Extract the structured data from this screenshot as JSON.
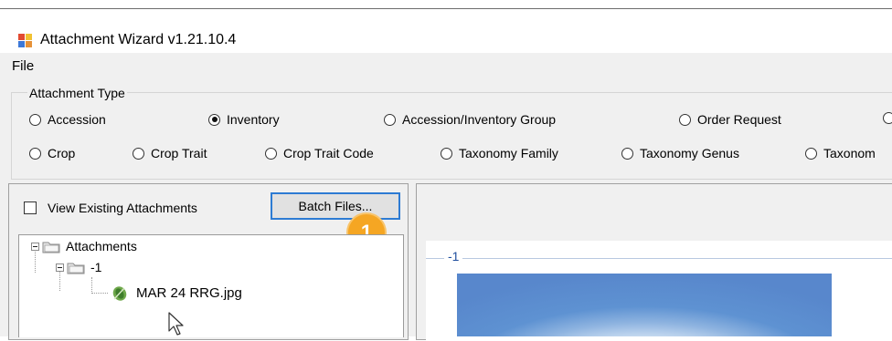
{
  "window": {
    "title": "Attachment Wizard v1.21.10.4"
  },
  "menu": {
    "items": [
      "File"
    ]
  },
  "attachment_type": {
    "legend": "Attachment Type",
    "row1": [
      {
        "label": "Accession",
        "selected": false
      },
      {
        "label": "Inventory",
        "selected": true
      },
      {
        "label": "Accession/Inventory Group",
        "selected": false
      },
      {
        "label": "Order Request",
        "selected": false
      }
    ],
    "row2": [
      {
        "label": "Crop",
        "selected": false
      },
      {
        "label": "Crop Trait",
        "selected": false
      },
      {
        "label": "Crop Trait Code",
        "selected": false
      },
      {
        "label": "Taxonomy Family",
        "selected": false
      },
      {
        "label": "Taxonomy Genus",
        "selected": false
      },
      {
        "label": "Taxonom",
        "selected": false
      }
    ]
  },
  "left_panel": {
    "view_existing_label": "View Existing Attachments",
    "view_existing_checked": false,
    "batch_button_label": "Batch Files...",
    "callout_number": "1"
  },
  "tree": {
    "root": {
      "label": "Attachments",
      "icon": "folder-icon"
    },
    "child": {
      "label": "-1",
      "icon": "folder-icon"
    },
    "leaf": {
      "label": "MAR 24 RRG.jpg",
      "icon": "image-file-icon"
    }
  },
  "preview": {
    "group_label": "-1"
  },
  "colors": {
    "accent": "#2d7bd3",
    "callout": "#f5a623",
    "preview_title": "#1f4e9e"
  }
}
